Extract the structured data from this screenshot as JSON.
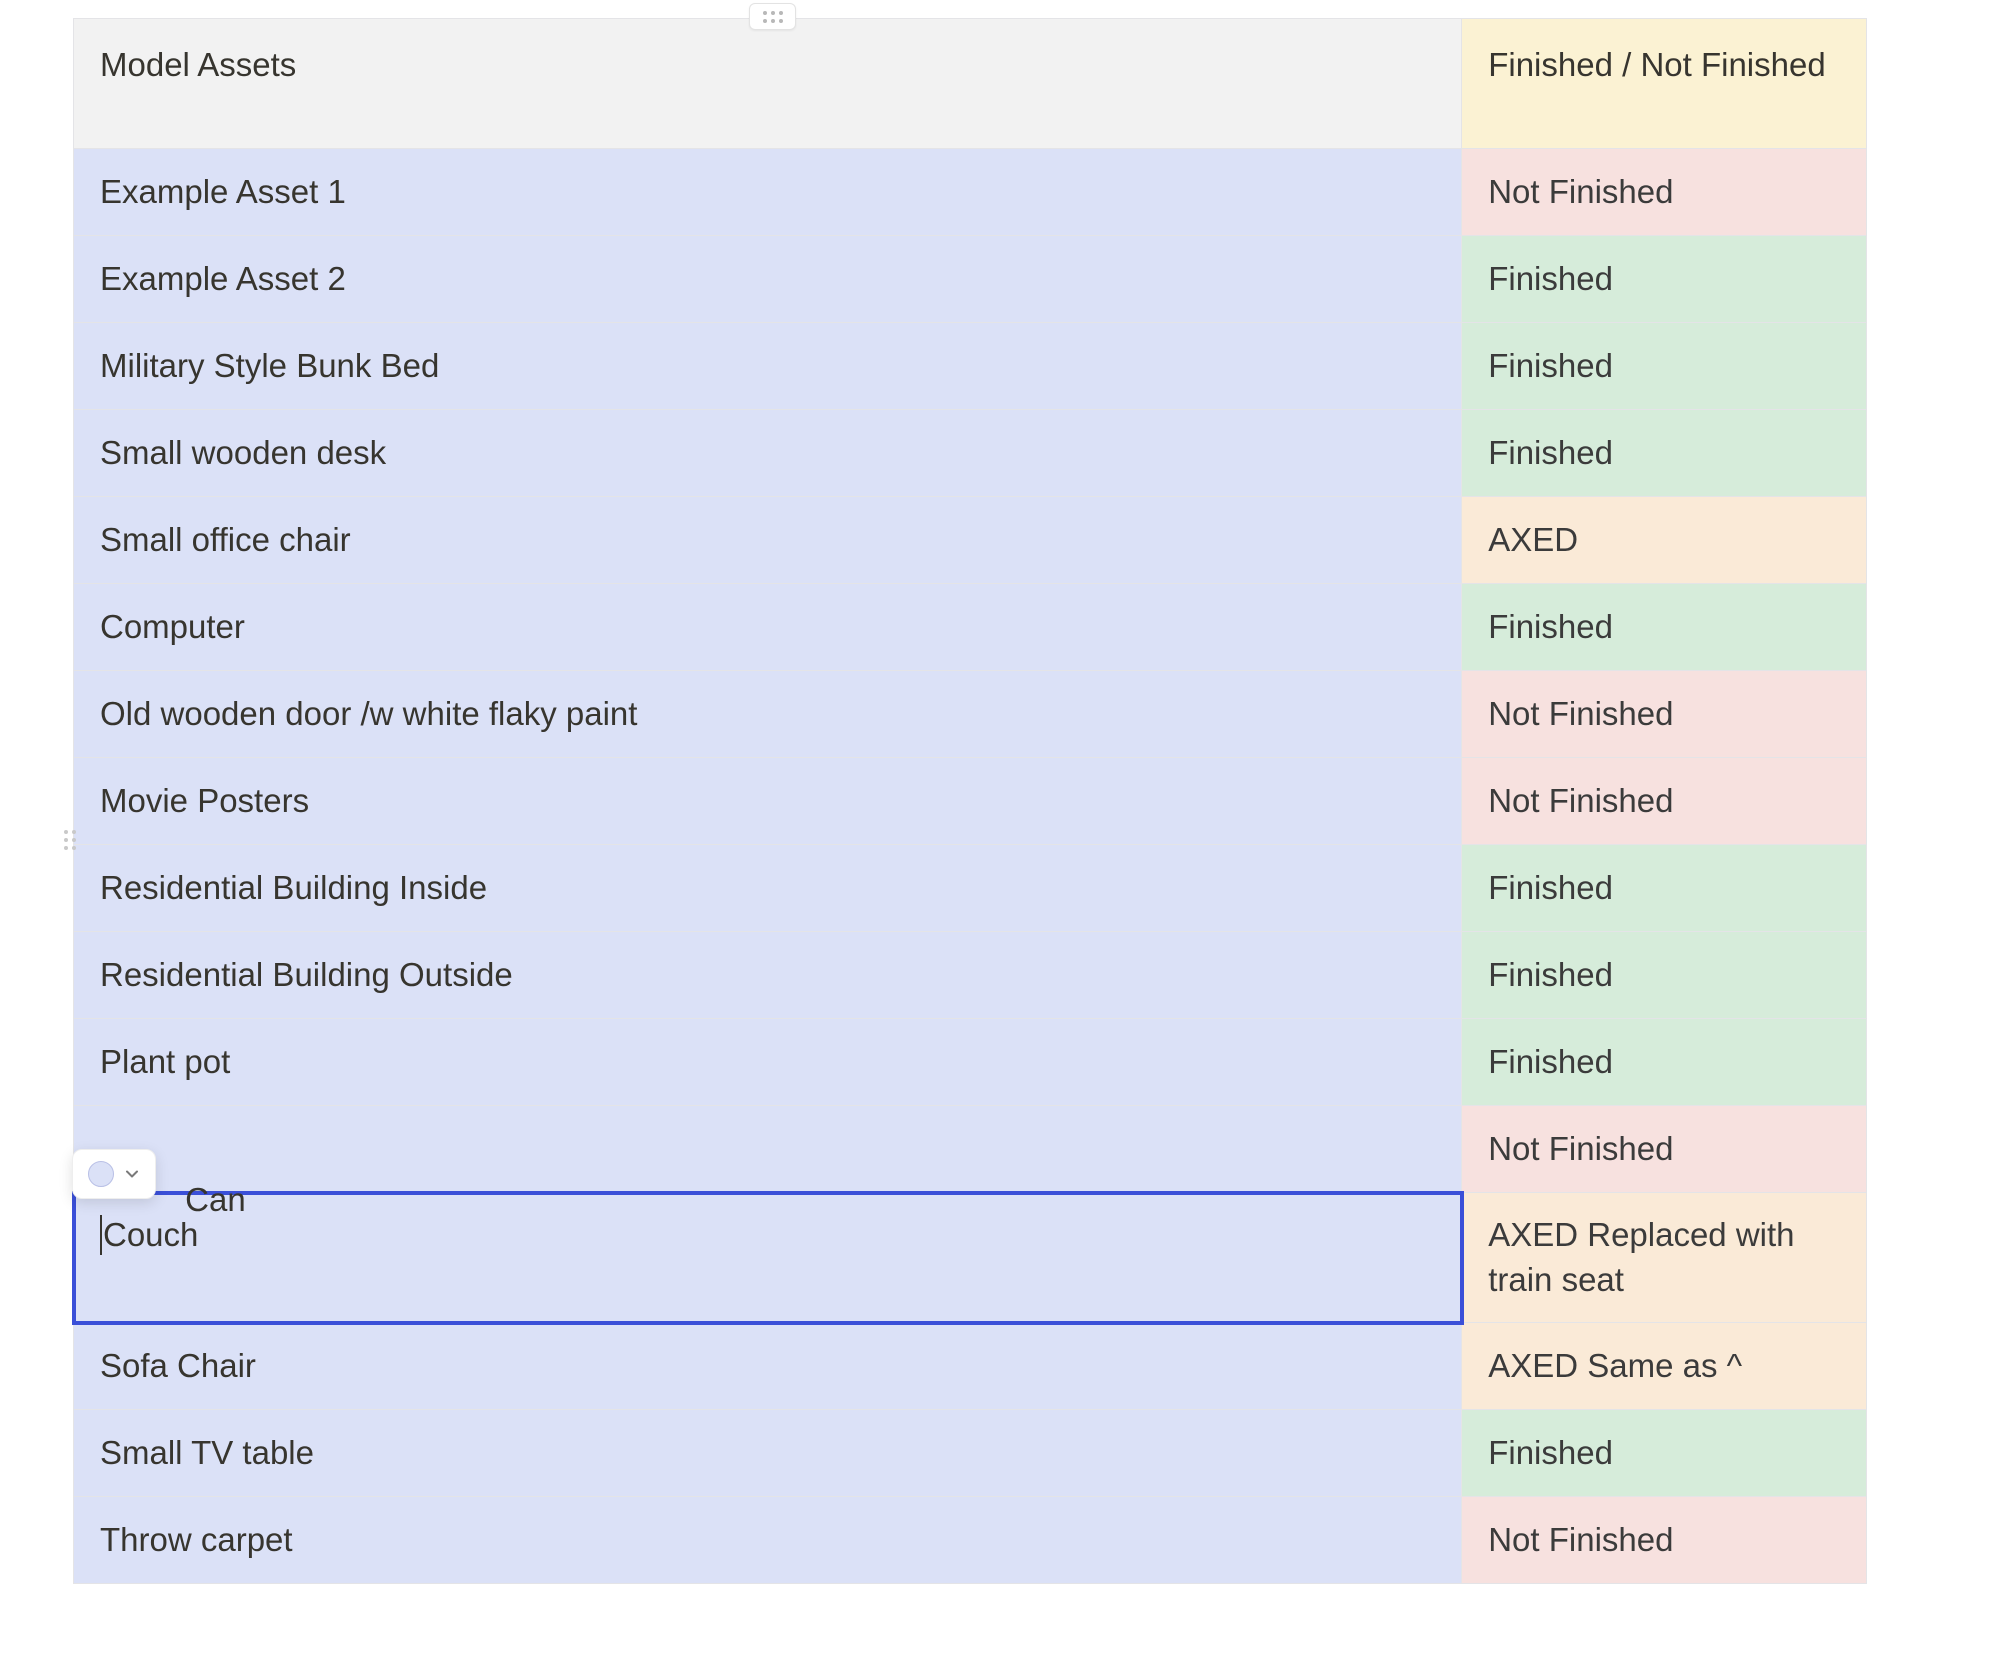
{
  "table": {
    "header": {
      "assets_label": "Model Assets",
      "status_label": "Finished / Not Finished"
    },
    "rows": [
      {
        "asset": "Example Asset 1",
        "status": "Not Finished",
        "status_kind": "notfinished"
      },
      {
        "asset": "Example Asset 2",
        "status": "Finished",
        "status_kind": "finished"
      },
      {
        "asset": "Military Style Bunk Bed",
        "status": "Finished",
        "status_kind": "finished"
      },
      {
        "asset": "Small wooden desk",
        "status": "Finished",
        "status_kind": "finished"
      },
      {
        "asset": "Small office chair",
        "status": "AXED",
        "status_kind": "axed"
      },
      {
        "asset": "Computer",
        "status": "Finished",
        "status_kind": "finished"
      },
      {
        "asset": "Old wooden door /w white flaky paint",
        "status": "Not Finished",
        "status_kind": "notfinished"
      },
      {
        "asset": "Movie Posters",
        "status": "Not Finished",
        "status_kind": "notfinished",
        "has_drag_handle": true
      },
      {
        "asset": "Residential Building Inside",
        "status": "Finished",
        "status_kind": "finished"
      },
      {
        "asset": "Residential Building Outside",
        "status": "Finished",
        "status_kind": "finished"
      },
      {
        "asset": "Plant pot",
        "status": "Finished",
        "status_kind": "finished"
      },
      {
        "asset": "Can",
        "status": "Not Finished",
        "status_kind": "notfinished",
        "truncated_by_popover": true,
        "visible_suffix": " Can"
      },
      {
        "asset": "Couch",
        "status": "AXED Replaced with train seat",
        "status_kind": "axed",
        "selected": true,
        "tall": true
      },
      {
        "asset": "Sofa Chair",
        "status": "AXED Same as ^",
        "status_kind": "axed"
      },
      {
        "asset": "Small TV table",
        "status": "Finished",
        "status_kind": "finished"
      },
      {
        "asset": "Throw carpet",
        "status": "Not Finished",
        "status_kind": "notfinished"
      }
    ]
  },
  "popover": {
    "swatch_color_name": "purple-light"
  }
}
